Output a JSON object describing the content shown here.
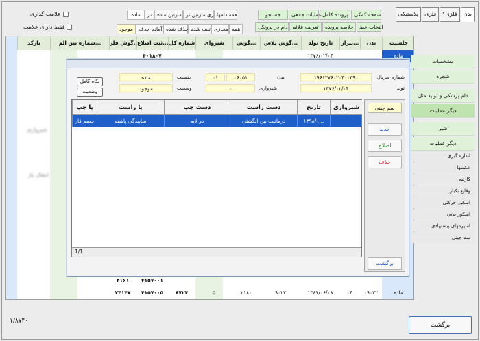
{
  "top_tabs": [
    "بدن",
    "فلزی؟",
    "فلزی",
    "پلاستیکی"
  ],
  "toolbar": {
    "row1": [
      "صفحه کمکی",
      "پرونده کامل",
      "عملیات جمعی",
      "جستجو"
    ],
    "row2": [
      "انتخاب خط",
      "خلاصه پرونده",
      "تعریف علائم",
      "دام در پروتکل"
    ],
    "filter_row1": [
      "ماده",
      "نر",
      "فری مارتین ماده",
      "فری مارتین نر",
      "همه دامها"
    ],
    "filter_row2": [
      "موجود",
      "آماده حذف",
      "حذف شده",
      "تلف شده",
      "مجازی",
      "همه"
    ],
    "checkbox_mark": "علامت گذاری",
    "checkbox_only_marked": "فقط دارای علامت"
  },
  "nav": {
    "items": [
      "مشخصات",
      "شجره",
      "دام پزشکی و تولید مثل",
      "دیگر عملیات",
      "شیر",
      "دیگر عملیات"
    ],
    "subitems": [
      "اندازه گیری",
      "عکسها",
      "کارتیه",
      "وقایع بکبار",
      "اسکور حرکتی",
      "اسکور بدنی",
      "اسپرمهای پیشنهادی",
      "سم چینی"
    ]
  },
  "bg_grid": {
    "headers": [
      "جلسیت",
      "بدن",
      "تنراژ...",
      "تاریخ تولد",
      "گوش پلاس...",
      "گوش...",
      "شیروای",
      "شماره کل",
      "ثبت اصلاع...",
      "گوش فلز...",
      "شماره بین الم...",
      "بارکد"
    ],
    "row_top": [
      "ماده",
      "#",
      "",
      "۱۳۷۶/۰۲/۰۴",
      "",
      "",
      "",
      "۴۰۱۸۰۷",
      "",
      "",
      "",
      ""
    ],
    "row_b1": [
      "",
      "",
      "",
      "",
      "",
      "",
      "",
      "",
      "",
      "۴۱۵۷۰۰۱",
      "۴۱۶۱",
      "",
      ""
    ],
    "row_b2": [
      "ماده",
      "۰۹۰۲۲",
      "۰۴",
      "۱۳۸۹/۰۶/۰۸",
      "۹۰۲۲",
      "۲۱۸۰",
      "۵",
      "۸۷۲۴",
      "۴۱۵۷۰۰۵",
      "۷۴۱۴۷"
    ],
    "blurred_labels": [
      "شیرواری",
      "انتقال یاژ"
    ]
  },
  "dialog": {
    "serial_label": "شماره سریال",
    "serial_value": "۱۹۶۱۳۷۶۰۲۰۴۰۰۳۹۰",
    "body_label": "بدن",
    "body_value": "۰۶۰۵۱",
    "gender_label": "جنسیت",
    "gender_value": "ماده",
    "birth_label": "تولد",
    "birth_value": "۱۳۷۶/۰۲/۰۴",
    "milking_label": "شیرواری",
    "milking_value": "۰",
    "status_label": "وضعیت",
    "status_value": "موجود",
    "number_value": "۰۱",
    "full_view_button": "نگاه کامل",
    "status_button": "وضعیت",
    "grid_headers": [
      "شیرواری",
      "تاریخ",
      "دست راست",
      "دست چپ",
      "پا راست",
      "پا چپ"
    ],
    "grid_row": [
      "",
      "۱۳۹۸/۰...",
      "درماتیت بین انگشتی",
      "دو لایه",
      "ساییدگی پاشنه",
      "چسم فار"
    ],
    "pager": "1/1",
    "side_top": "سم چینی",
    "new_button": "جدید",
    "edit_button": "اصلاح",
    "delete_button": "حذف",
    "back_button": "برگشت"
  },
  "status_count": "۱/۸۷۴۰",
  "bottom_back_button": "برگشت"
}
